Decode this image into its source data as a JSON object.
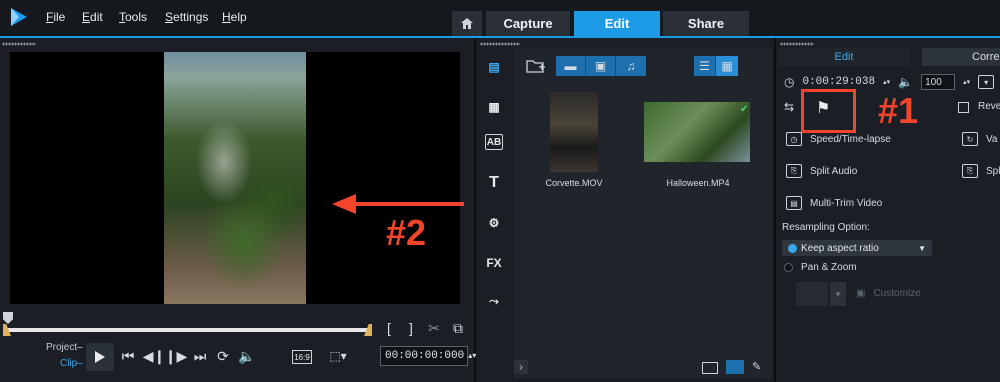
{
  "app": {
    "menu": [
      {
        "label": "File",
        "underline": "F",
        "rest": "ile"
      },
      {
        "label": "Edit",
        "underline": "E",
        "rest": "dit"
      },
      {
        "label": "Tools",
        "underline": "T",
        "rest": "ools"
      },
      {
        "label": "Settings",
        "underline": "S",
        "rest": "ettings"
      },
      {
        "label": "Help",
        "underline": "H",
        "rest": "elp"
      }
    ],
    "tabs": {
      "capture": "Capture",
      "edit": "Edit",
      "share": "Share"
    },
    "accent_color": "#1e9be6"
  },
  "player": {
    "project_label": "Project",
    "clip_label": "Clip",
    "aspect_label": "16:9",
    "timecode": "00:00:00:000"
  },
  "library": {
    "items": [
      {
        "name": "Corvette.MOV"
      },
      {
        "name": "Halloween.MP4"
      }
    ]
  },
  "options": {
    "tab_edit": "Edit",
    "tab_correct": "Corre",
    "duration": "0:00:29:038",
    "volume": "100",
    "reverse_label": "Reve",
    "speed_label": "Speed/Time-lapse",
    "variable_label": "Va",
    "split_audio_label": "Split Audio",
    "split_scene_label": "Spl",
    "multi_trim_label": "Multi-Trim Video",
    "resampling_label": "Resampling Option:",
    "keep_aspect_label": "Keep aspect ratio",
    "pan_zoom_label": "Pan & Zoom",
    "customize_label": "Customize"
  },
  "annotations": {
    "label1": "#1",
    "label2": "#2",
    "annotation_color": "#f2452b"
  }
}
